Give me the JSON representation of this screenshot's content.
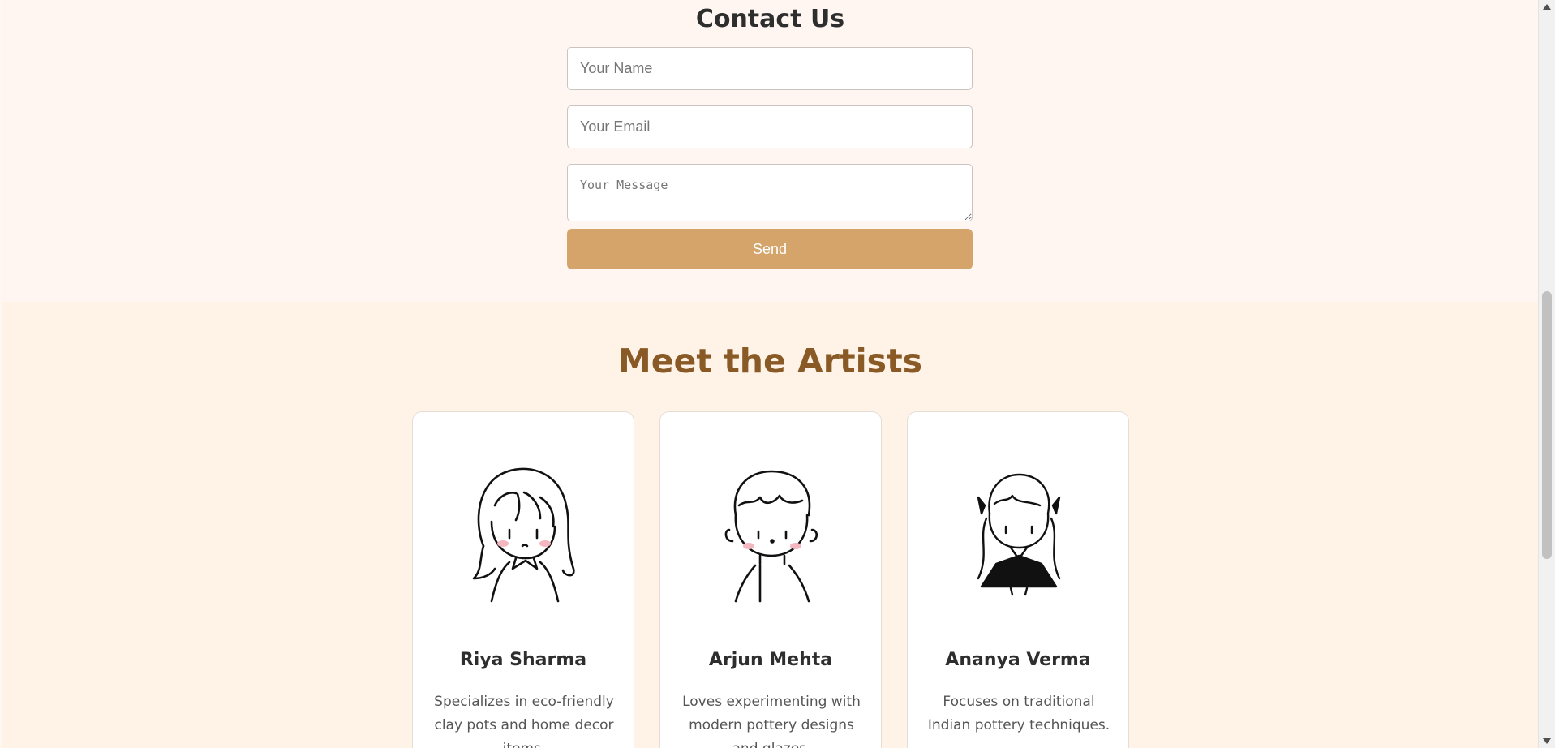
{
  "contact": {
    "title": "Contact Us",
    "name_placeholder": "Your Name",
    "email_placeholder": "Your Email",
    "message_placeholder": "Your Message",
    "send_label": "Send",
    "send_color": "#d4a46b"
  },
  "artists": {
    "title": "Meet the Artists",
    "title_color": "#8a5a26",
    "cards": [
      {
        "name": "Riya Sharma",
        "desc": "Specializes in eco-friendly clay pots and home decor items.",
        "avatar": "girl-long-hair-illustration"
      },
      {
        "name": "Arjun Mehta",
        "desc": "Loves experimenting with modern pottery designs and glazes.",
        "avatar": "boy-short-hair-illustration"
      },
      {
        "name": "Ananya Verma",
        "desc": "Focuses on traditional Indian pottery techniques.",
        "avatar": "girl-black-dress-illustration"
      }
    ]
  }
}
